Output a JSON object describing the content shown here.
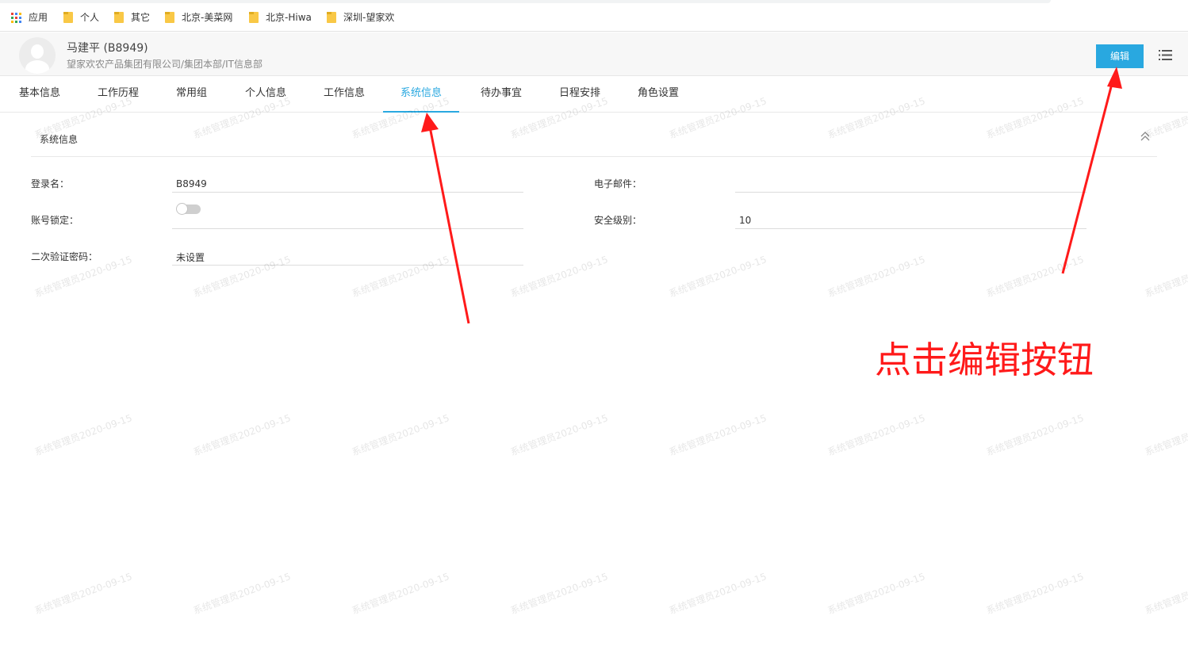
{
  "bookmarks": [
    {
      "label": "应用",
      "icon": "apps-grid-icon"
    },
    {
      "label": "个人",
      "icon": "folder-icon"
    },
    {
      "label": "其它",
      "icon": "folder-icon"
    },
    {
      "label": "北京-美菜网",
      "icon": "folder-icon"
    },
    {
      "label": "北京-Hiwa",
      "icon": "folder-icon"
    },
    {
      "label": "深圳-望家欢",
      "icon": "folder-icon"
    }
  ],
  "profile": {
    "name": "马建平 (B8949)",
    "org": "望家欢农产品集团有限公司/集团本部/IT信息部",
    "edit_label": "编辑",
    "accent": "#29a8e0"
  },
  "tabs": [
    {
      "label": "基本信息"
    },
    {
      "label": "工作历程"
    },
    {
      "label": "常用组"
    },
    {
      "label": "个人信息"
    },
    {
      "label": "工作信息"
    },
    {
      "label": "系统信息",
      "active": true
    },
    {
      "label": "待办事宜"
    },
    {
      "label": "日程安排"
    },
    {
      "label": "角色设置"
    }
  ],
  "section": {
    "title": "系统信息"
  },
  "fields": {
    "login_name": {
      "label": "登录名：",
      "value": "B8949"
    },
    "email": {
      "label": "电子邮件：",
      "value": ""
    },
    "account_lock": {
      "label": "账号锁定：",
      "enabled": false
    },
    "security_level": {
      "label": "安全级别：",
      "value": "10"
    },
    "two_factor": {
      "label": "二次验证密码：",
      "value": "未设置"
    }
  },
  "watermark": "系统管理员2020-09-15",
  "annotation": {
    "text": "点击编辑按钮",
    "color": "#ff1a1a"
  }
}
